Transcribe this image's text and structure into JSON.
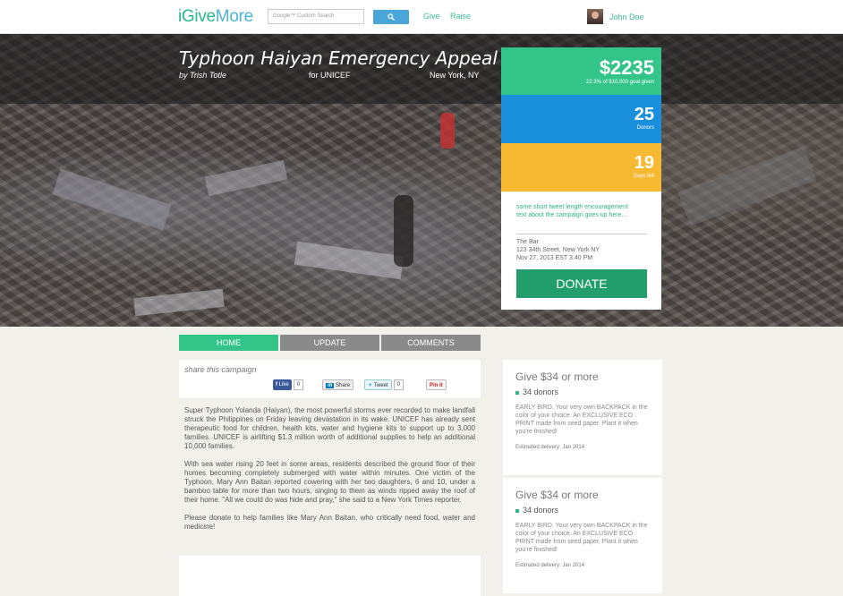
{
  "header": {
    "logo_main": "iGive",
    "logo_accent": "More",
    "search_placeholder": "Google™ Custom Search",
    "nav": [
      "Give",
      "Raise"
    ],
    "user_name": "John Doe"
  },
  "campaign": {
    "title": "Typhoon Haiyan Emergency Appeal",
    "author": "by Trish Totle",
    "organization": "for UNICEF",
    "location": "New York, NY"
  },
  "stats": {
    "amount": "$2235",
    "amount_label": "22.3% of $10,000 goal given",
    "donors": "25",
    "donors_label": "Donors",
    "days": "19",
    "days_label": "Days left",
    "colors": {
      "amount": "#33c48a",
      "donors": "#1a8fdb",
      "days": "#f7b932"
    }
  },
  "info": {
    "tweet": "some short tweet length encouragement text about the campaign goes up here...",
    "venue_name": "The Bar",
    "venue_address": "123 34th Street, New York NY",
    "venue_date": "Nov 27, 2013 EST 3.40 PM",
    "donate_label": "DONATE"
  },
  "tabs": [
    "HOME",
    "UPDATE",
    "COMMENTS"
  ],
  "share": {
    "title": "share this campaign",
    "like_label": "Like",
    "like_count": "0",
    "share_label": "Share",
    "tweet_label": "Tweet",
    "tweet_count": "0",
    "pin_label": "Pin it"
  },
  "article": [
    "Super Typhoon Yolanda (Haiyan), the most powerful storms ever recorded to make landfall struck the Philippines on Friday leaving devastation in its wake. UNICEF has already sent therapeutic food for children, health kits, water and hygiene kits to support up to 3,000 families. UNICEF is airlifting $1.3 million worth of additional supplies to help an additional 10,000 families.",
    "With sea water rising 20 feet in some areas, residents described the ground floor of their homes becoming completely submerged with water within minutes. One victim of the Typhoon, Mary Ann Baitan reported cowering with her two daughters, 6 and 10, under a bamboo table for more than two hours, singing to them as winds ripped away the roof of their home. \"All we could do was hide and pray,\" she said to a New York Times reporter.",
    "Please donate to help families like Mary Ann Baitan, who critically need food, water and medicine!"
  ],
  "rewards": [
    {
      "title": "Give $34 or more",
      "donors": "34 donors",
      "description": "EARLY BIRD. Your very own BACKPACK in the color of your choice. An EXCLUSIVE ECO PRINT made from seed paper. Plant it when you're finished!",
      "delivery": "Estimated delivery: Jan 2014"
    },
    {
      "title": "Give $34 or more",
      "donors": "34 donors",
      "description": "EARLY BIRD. Your very own BACKPACK in the color of your choice. An EXCLUSIVE ECO PRINT made from seed paper. Plant it when you're finished!",
      "delivery": "Estimated delivery: Jan 2014"
    }
  ]
}
